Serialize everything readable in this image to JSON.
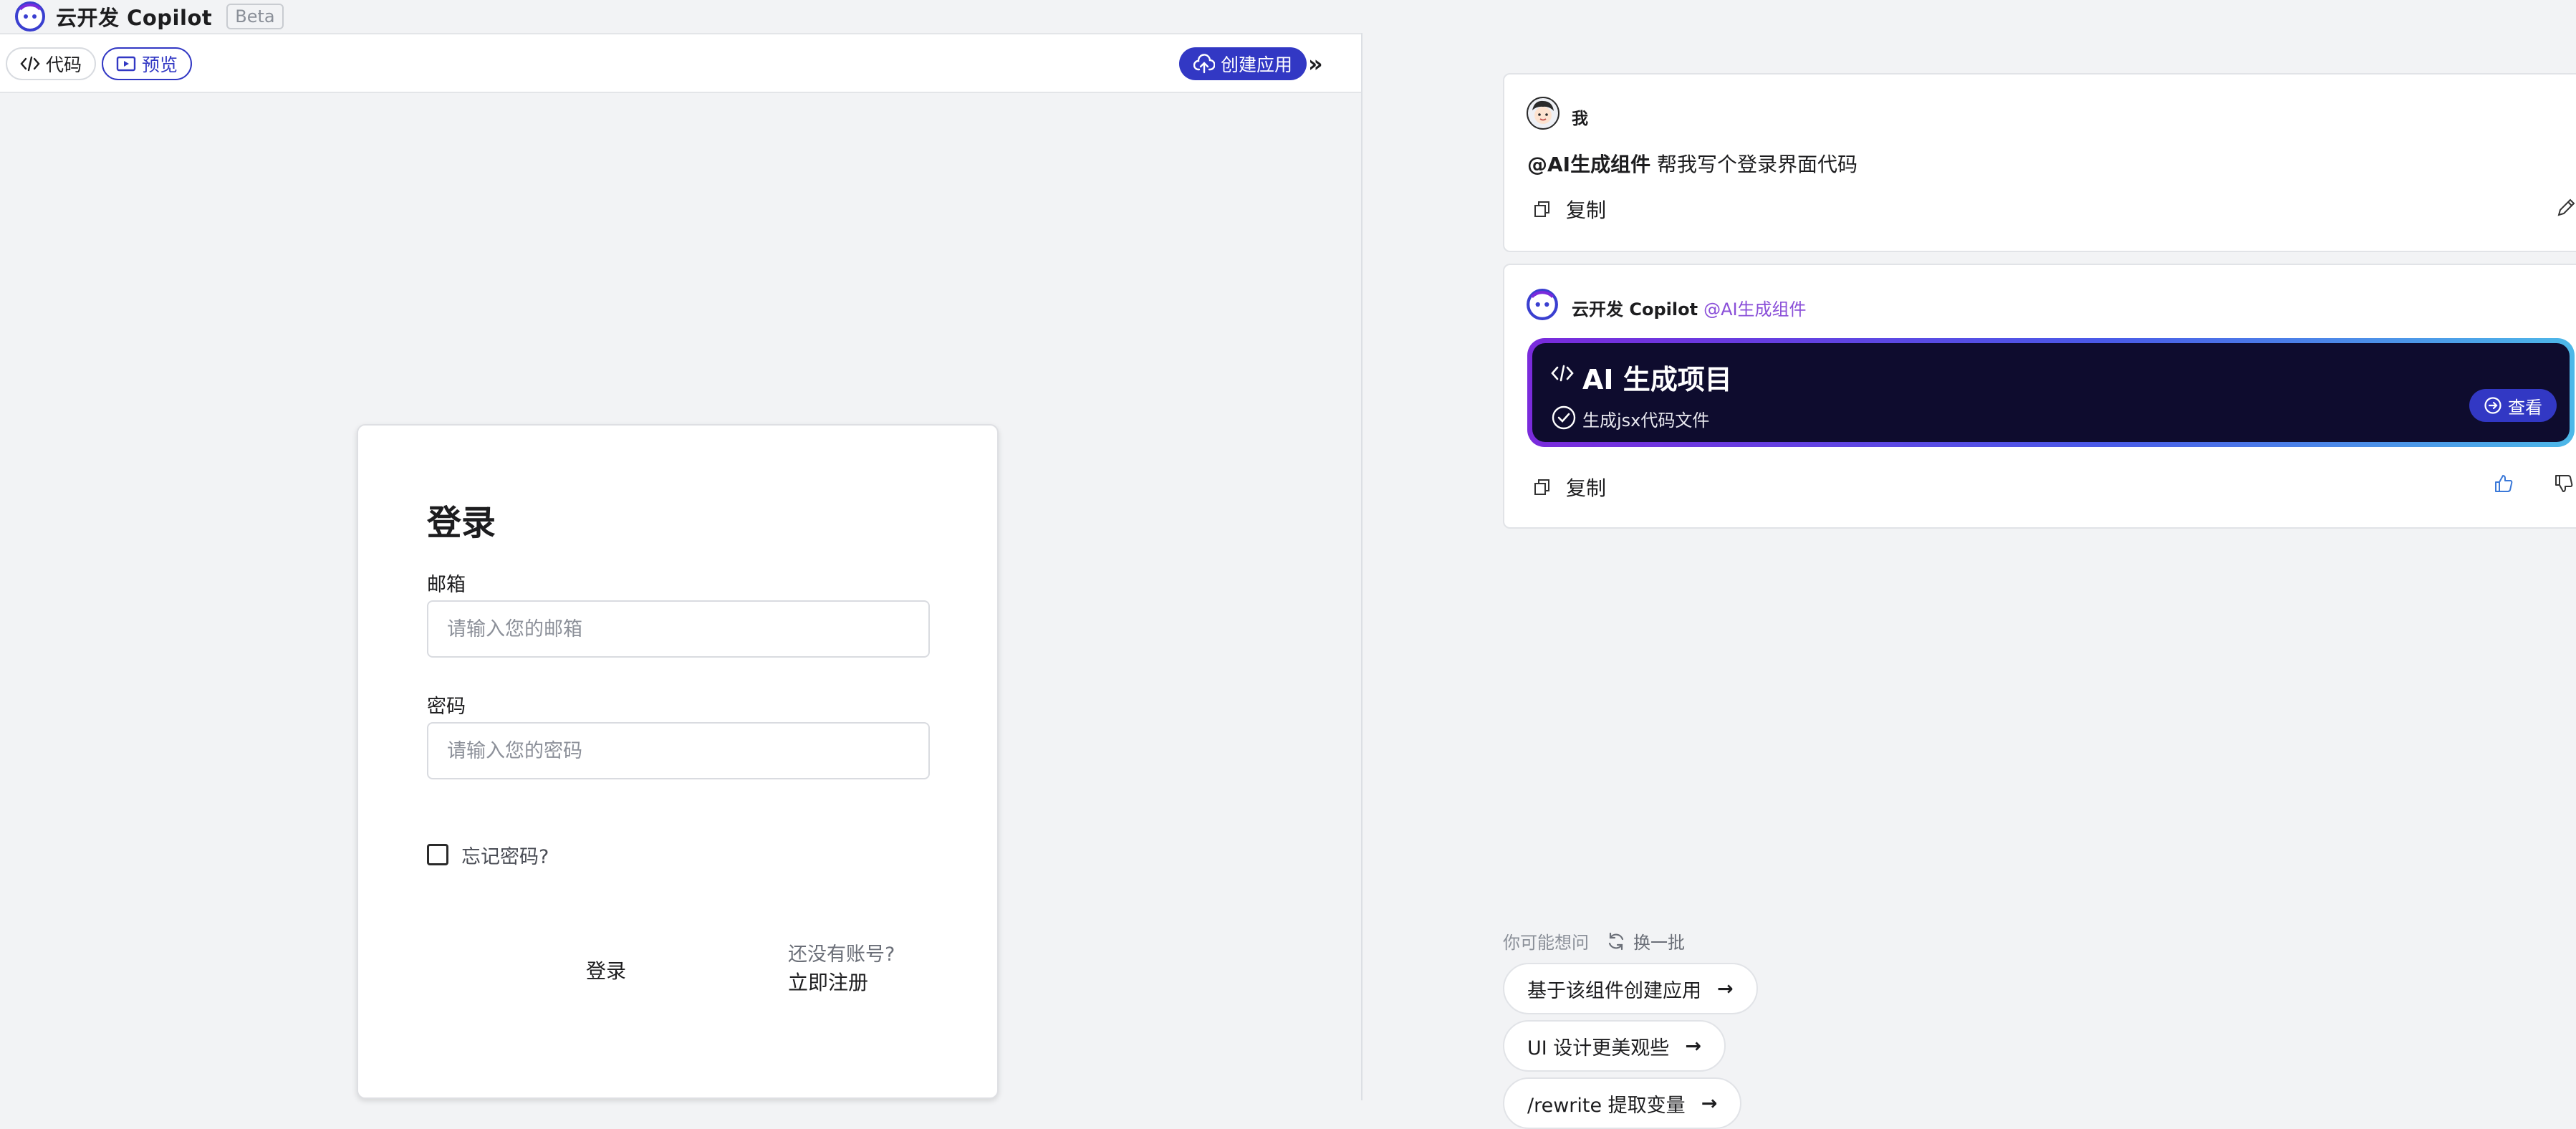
{
  "app": {
    "title": "云开发 Copilot",
    "badge": "Beta"
  },
  "toolbar": {
    "code_label": "代码",
    "preview_label": "预览",
    "create_label": "创建应用",
    "collapse_glyph": "»"
  },
  "login": {
    "title": "登录",
    "email_label": "邮箱",
    "email_placeholder": "请输入您的邮箱",
    "password_label": "密码",
    "password_placeholder": "请输入您的密码",
    "remember_label": "忘记密码?",
    "submit_label": "登录",
    "no_account": "还没有账号?",
    "register_label": "立即注册"
  },
  "chat": {
    "user": {
      "name": "我",
      "mention": "@AI生成组件",
      "message": " 帮我写个登录界面代码",
      "copy_label": "复制"
    },
    "bot": {
      "name": "云开发 Copilot",
      "tag": "@AI生成组件",
      "project_title": "AI 生成项目",
      "project_status": "生成jsx代码文件",
      "view_label": "查看",
      "copy_label": "复制"
    }
  },
  "suggestions": {
    "heading": "你可能想问",
    "refresh_label": "换一批",
    "items": [
      {
        "label": "基于该组件创建应用",
        "arrow": "→"
      },
      {
        "label": "UI 设计更美观些",
        "arrow": "→"
      },
      {
        "label": "/rewrite 提取变量",
        "arrow": "→"
      }
    ]
  },
  "colors": {
    "accent": "#3238c4",
    "banner_start": "#7a2bdc",
    "banner_end": "#4db8e8",
    "banner_bg": "#0e0c2e"
  }
}
